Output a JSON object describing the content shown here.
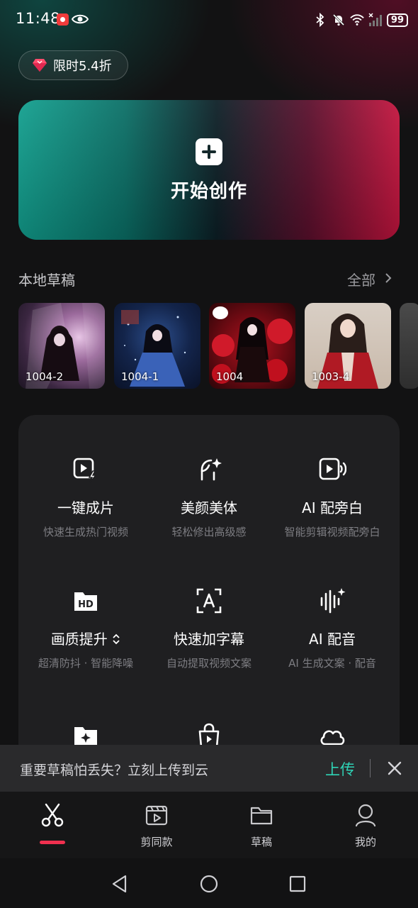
{
  "status_bar": {
    "time": "11:48",
    "battery": "99"
  },
  "promo": {
    "label": "限时5.4折"
  },
  "create": {
    "label": "开始创作"
  },
  "drafts": {
    "title": "本地草稿",
    "all_label": "全部",
    "items": [
      {
        "label": "1004-2"
      },
      {
        "label": "1004-1"
      },
      {
        "label": "1004"
      },
      {
        "label": "1003-4"
      }
    ]
  },
  "tools": [
    {
      "title": "一键成片",
      "subtitle": "快速生成热门视频",
      "icon": "play-bolt-icon"
    },
    {
      "title": "美颜美体",
      "subtitle": "轻松修出高级感",
      "icon": "face-sparkle-icon"
    },
    {
      "title": "AI 配旁白",
      "subtitle": "智能剪辑视频配旁白",
      "icon": "play-voice-icon"
    },
    {
      "title": "画质提升",
      "subtitle": "超清防抖 · 智能降噪",
      "icon": "hd-icon"
    },
    {
      "title": "快速加字幕",
      "subtitle": "自动提取视频文案",
      "icon": "text-scan-icon"
    },
    {
      "title": "AI 配音",
      "subtitle": "AI 生成文案 · 配音",
      "icon": "waveform-sparkle-icon"
    },
    {
      "title": "",
      "subtitle": "",
      "icon": "folder-star-icon"
    },
    {
      "title": "",
      "subtitle": "",
      "icon": "shopping-bag-icon"
    },
    {
      "title": "",
      "subtitle": "",
      "icon": "cloud-icon"
    }
  ],
  "cloud_banner": {
    "text": "重要草稿怕丢失？立刻上传到云",
    "action": "上传"
  },
  "bottom_nav": [
    {
      "label": "",
      "icon": "scissors-icon",
      "active": true
    },
    {
      "label": "剪同款",
      "icon": "clapper-icon"
    },
    {
      "label": "草稿",
      "icon": "folder-icon"
    },
    {
      "label": "我的",
      "icon": "person-icon"
    }
  ],
  "colors": {
    "accent_teal": "#2fd3b6",
    "accent_red": "#f0304f",
    "panel": "#1f1f21",
    "background": "#121213"
  }
}
